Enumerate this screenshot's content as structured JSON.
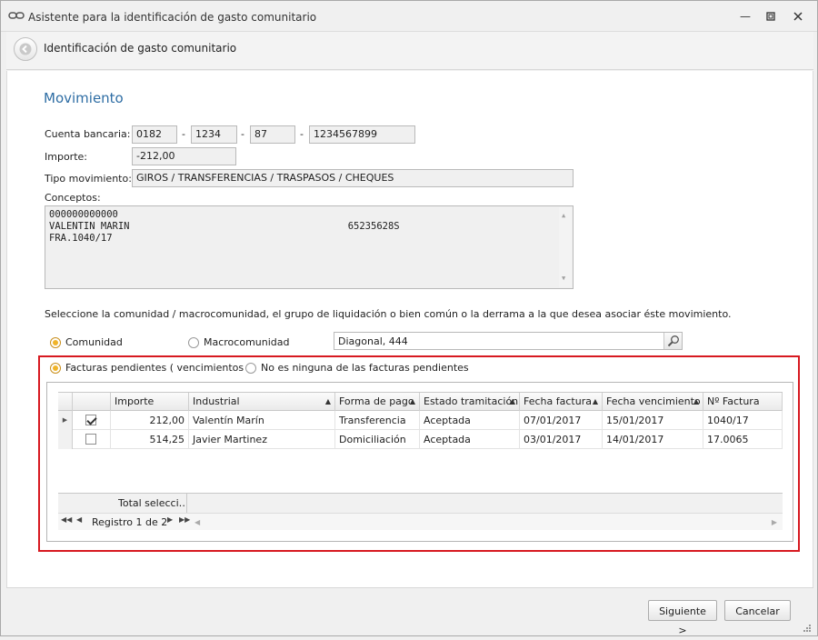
{
  "window": {
    "title": "Asistente para la identificación de gasto comunitario",
    "app_icon": "chain-link-icon",
    "controls": [
      "minimize-icon",
      "maximize-icon",
      "close-icon"
    ]
  },
  "header": {
    "title": "Identificación de gasto comunitario",
    "back_icon": "back-arrow-icon"
  },
  "movimiento": {
    "section_title": "Movimiento",
    "cuenta_label": "Cuenta bancaria:",
    "cuenta": {
      "entidad": "0182",
      "oficina": "1234",
      "dc": "87",
      "numero": "1234567899",
      "sep": "-"
    },
    "importe_label": "Importe:",
    "importe": "-212,00",
    "tipo_label": "Tipo movimiento:",
    "tipo": "GIROS / TRANSFERENCIAS / TRASPASOS / CHEQUES",
    "conceptos_label": "Conceptos:",
    "conceptos": [
      "000000000000",
      "VALENTIN MARIN                                      65235628S",
      "FRA.1040/17"
    ]
  },
  "selection": {
    "instruction": "Seleccione la comunidad / macrocomunidad, el grupo de liquidación o bien común o la derrama a la que desea asociar éste movimiento.",
    "radio_comunidad": "Comunidad",
    "radio_macro": "Macrocomunidad",
    "selected_scope": "comunidad",
    "comunidad_value": "Diagonal, 444",
    "search_icon": "search-icon"
  },
  "facturas": {
    "radio_pendientes": "Facturas pendientes ( vencimientos )",
    "radio_ninguna": "No es ninguna de las facturas pendientes",
    "selected": "pendientes",
    "columns": [
      "Importe",
      "Industrial",
      "Forma de pago",
      "Estado tramitación",
      "Fecha factura",
      "Fecha vencimiento",
      "Nº Factura"
    ],
    "rows": [
      {
        "checked": true,
        "importe": "212,00",
        "industrial": "Valentín Marín",
        "forma_pago": "Transferencia",
        "estado": "Aceptada",
        "fecha_factura": "07/01/2017",
        "fecha_vencimiento": "15/01/2017",
        "n_factura": "1040/17"
      },
      {
        "checked": false,
        "importe": "514,25",
        "industrial": "Javier Martinez",
        "forma_pago": "Domiciliación",
        "estado": "Aceptada",
        "fecha_factura": "03/01/2017",
        "fecha_vencimiento": "14/01/2017",
        "n_factura": "17.0065"
      }
    ],
    "total_label": "Total selecci…",
    "record_text": "Registro 1 de 2"
  },
  "buttons": {
    "next": "Siguiente >",
    "cancel": "Cancelar"
  },
  "colors": {
    "accent_title": "#2e6da4",
    "highlight_frame": "#d71920",
    "radio_selected": "#f0b429"
  }
}
